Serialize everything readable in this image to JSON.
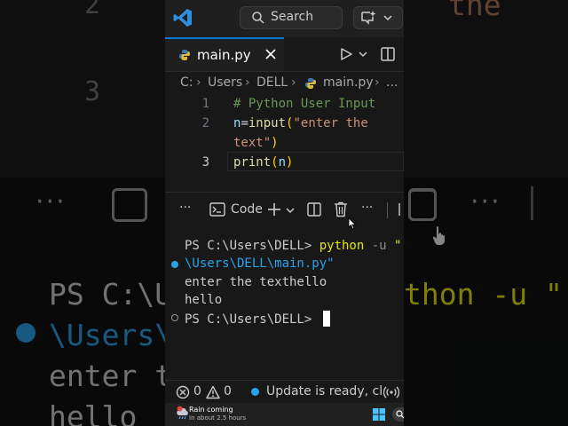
{
  "background": {
    "line_numbers": [
      "2",
      "3"
    ],
    "top_text": "the",
    "prompt_fragment": "PS C:\\U",
    "cmd_fragment": "thon -u \"",
    "path_fragment": "\\Users\\",
    "output_fragment": "enter t",
    "hello_fragment": "hello",
    "dots": "···"
  },
  "titlebar": {
    "search_label": "Search",
    "icons": [
      "vscode-logo",
      "search-icon",
      "copilot-icon",
      "chevron-down-icon"
    ]
  },
  "tab": {
    "filename": "main.py",
    "icons": [
      "python-icon",
      "close-icon",
      "run-icon",
      "split-editor-icon"
    ]
  },
  "breadcrumb": {
    "items": [
      "C:",
      "Users",
      "DELL",
      "main.py",
      "..."
    ]
  },
  "editor": {
    "line_numbers": [
      "1",
      "2",
      "3"
    ],
    "lines": [
      {
        "comment": "# Python User Input"
      },
      {
        "var": "n",
        "op": "=",
        "fn": "input",
        "open": "(",
        "str1": "\"enter the",
        "str2": "text\"",
        "close": ")"
      },
      {
        "fn": "print",
        "open": "(",
        "var": "n",
        "close": ")"
      }
    ]
  },
  "terminal_toolbar": {
    "more_left": "···",
    "code_label": "Code",
    "more_right": "···",
    "icons": [
      "terminal-icon",
      "plus-icon",
      "chevron-down-icon",
      "split-terminal-icon",
      "trash-icon",
      "more-icon"
    ]
  },
  "terminal": {
    "prompt1": "PS C:\\Users\\DELL> ",
    "cmd": "python",
    "flag": " -u ",
    "str_start": "\"",
    "path_line": "\\Users\\DELL\\main.py\"",
    "output1": "enter the texthello",
    "output2": "hello",
    "prompt2": "PS C:\\Users\\DELL> "
  },
  "statusbar": {
    "errors": "0",
    "warnings": "0",
    "update_text": "Update is ready, cl",
    "icons": [
      "error-icon",
      "warning-icon",
      "info-dot-icon",
      "broadcast-icon"
    ]
  },
  "taskbar": {
    "weather_title": "Rain coming",
    "weather_sub": "In about 2.5 hours",
    "icons": [
      "weather-icon",
      "windows-logo-icon",
      "search-icon"
    ]
  },
  "colors": {
    "accent": "#0078d4",
    "terminal_yellow": "#e5e510",
    "path_blue": "#2aa2e8",
    "string": "#ce9178",
    "comment": "#6a9955"
  }
}
